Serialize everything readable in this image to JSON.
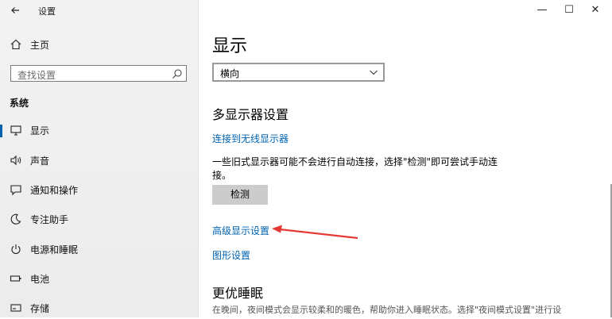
{
  "window": {
    "title": "设置",
    "controls": {
      "minimize": "—",
      "maximize": "☐",
      "close": "✕"
    }
  },
  "sidebar": {
    "home": "主页",
    "search_placeholder": "查找设置",
    "section": "系统",
    "items": [
      {
        "label": "显示",
        "icon": "monitor-icon",
        "active": true
      },
      {
        "label": "声音",
        "icon": "speaker-icon"
      },
      {
        "label": "通知和操作",
        "icon": "notification-icon"
      },
      {
        "label": "专注助手",
        "icon": "moon-icon"
      },
      {
        "label": "电源和睡眠",
        "icon": "power-icon"
      },
      {
        "label": "电池",
        "icon": "battery-icon"
      },
      {
        "label": "存储",
        "icon": "storage-icon"
      }
    ]
  },
  "main": {
    "title": "显示",
    "orientation_value": "横向",
    "multi_display_heading": "多显示器设置",
    "wireless_link": "连接到无线显示器",
    "detect_description": "一些旧式显示器可能不会进行自动连接，选择\"检测\"即可尝试手动连接。",
    "detect_button": "检测",
    "advanced_link": "高级显示设置",
    "graphics_link": "图形设置",
    "sleep_heading": "更优睡眠",
    "sleep_description": "在晚间，夜间模式会显示较柔和的暖色，帮助你进入睡眠状态。选择\"夜间模式设置\"进行设"
  },
  "colors": {
    "accent": "#0063b1",
    "annotation_arrow": "#e53935"
  }
}
